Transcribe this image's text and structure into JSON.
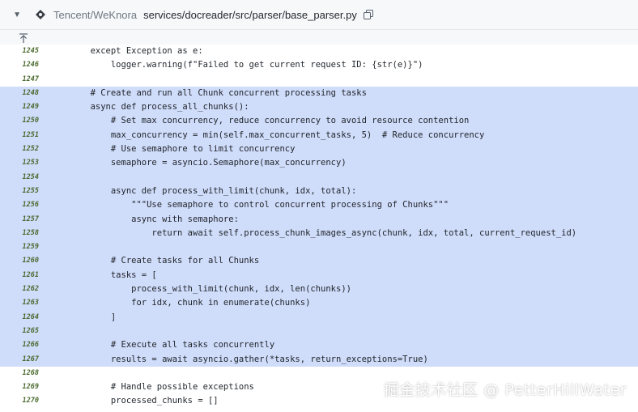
{
  "header": {
    "repo": "Tencent/WeKnora",
    "path": "services/docreader/src/parser/base_parser.py",
    "caret_icon": "caret-down-icon",
    "repo_icon": "repo-icon",
    "copy_icon": "copy-icon"
  },
  "expander": {
    "icon": "expand-up-icon"
  },
  "lines": [
    {
      "num": "1245",
      "text": "        except Exception as e:",
      "hl": false
    },
    {
      "num": "1246",
      "text": "            logger.warning(f\"Failed to get current request ID: {str(e)}\")",
      "hl": false
    },
    {
      "num": "1247",
      "text": "",
      "hl": false
    },
    {
      "num": "1248",
      "text": "        # Create and run all Chunk concurrent processing tasks",
      "hl": true
    },
    {
      "num": "1249",
      "text": "        async def process_all_chunks():",
      "hl": true
    },
    {
      "num": "1250",
      "text": "            # Set max concurrency, reduce concurrency to avoid resource contention",
      "hl": true
    },
    {
      "num": "1251",
      "text": "            max_concurrency = min(self.max_concurrent_tasks, 5)  # Reduce concurrency",
      "hl": true
    },
    {
      "num": "1252",
      "text": "            # Use semaphore to limit concurrency",
      "hl": true
    },
    {
      "num": "1253",
      "text": "            semaphore = asyncio.Semaphore(max_concurrency)",
      "hl": true
    },
    {
      "num": "1254",
      "text": "",
      "hl": true
    },
    {
      "num": "1255",
      "text": "            async def process_with_limit(chunk, idx, total):",
      "hl": true
    },
    {
      "num": "1256",
      "text": "                \"\"\"Use semaphore to control concurrent processing of Chunks\"\"\"",
      "hl": true
    },
    {
      "num": "1257",
      "text": "                async with semaphore:",
      "hl": true
    },
    {
      "num": "1258",
      "text": "                    return await self.process_chunk_images_async(chunk, idx, total, current_request_id)",
      "hl": true
    },
    {
      "num": "1259",
      "text": "",
      "hl": true
    },
    {
      "num": "1260",
      "text": "            # Create tasks for all Chunks",
      "hl": true
    },
    {
      "num": "1261",
      "text": "            tasks = [",
      "hl": true
    },
    {
      "num": "1262",
      "text": "                process_with_limit(chunk, idx, len(chunks))",
      "hl": true
    },
    {
      "num": "1263",
      "text": "                for idx, chunk in enumerate(chunks)",
      "hl": true
    },
    {
      "num": "1264",
      "text": "            ]",
      "hl": true
    },
    {
      "num": "1265",
      "text": "",
      "hl": true
    },
    {
      "num": "1266",
      "text": "            # Execute all tasks concurrently",
      "hl": true
    },
    {
      "num": "1267",
      "text": "            results = await asyncio.gather(*tasks, return_exceptions=True)",
      "hl": true
    },
    {
      "num": "1268",
      "text": "",
      "hl": false
    },
    {
      "num": "1269",
      "text": "            # Handle possible exceptions",
      "hl": false
    },
    {
      "num": "1270",
      "text": "            processed_chunks = []",
      "hl": false
    }
  ],
  "watermark": "掘金技术社区 @ PetterHillWater"
}
